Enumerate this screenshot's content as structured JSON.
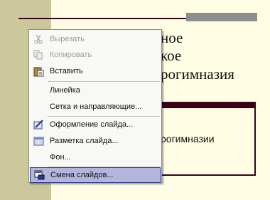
{
  "slide": {
    "title_lines": [
      "ное",
      "кое",
      "рогимназия"
    ],
    "subtitle": "рогимназии"
  },
  "menu": {
    "items": [
      {
        "label": "Вырезать",
        "icon": "scissors-icon",
        "enabled": false
      },
      {
        "label": "Копировать",
        "icon": "copy-icon",
        "enabled": false
      },
      {
        "label": "Вставить",
        "icon": "paste-icon",
        "enabled": true
      },
      {
        "label": "Линейка",
        "icon": "",
        "enabled": true
      },
      {
        "label": "Сетка и направляющие...",
        "icon": "",
        "enabled": true
      },
      {
        "label": "Оформление слайда...",
        "icon": "slide-design-icon",
        "enabled": true
      },
      {
        "label": "Разметка слайда...",
        "icon": "slide-layout-icon",
        "enabled": true
      },
      {
        "label": "Фон...",
        "icon": "",
        "enabled": true
      },
      {
        "label": "Смена слайдов...",
        "icon": "slide-transition-icon",
        "enabled": true,
        "highlighted": true
      }
    ]
  }
}
